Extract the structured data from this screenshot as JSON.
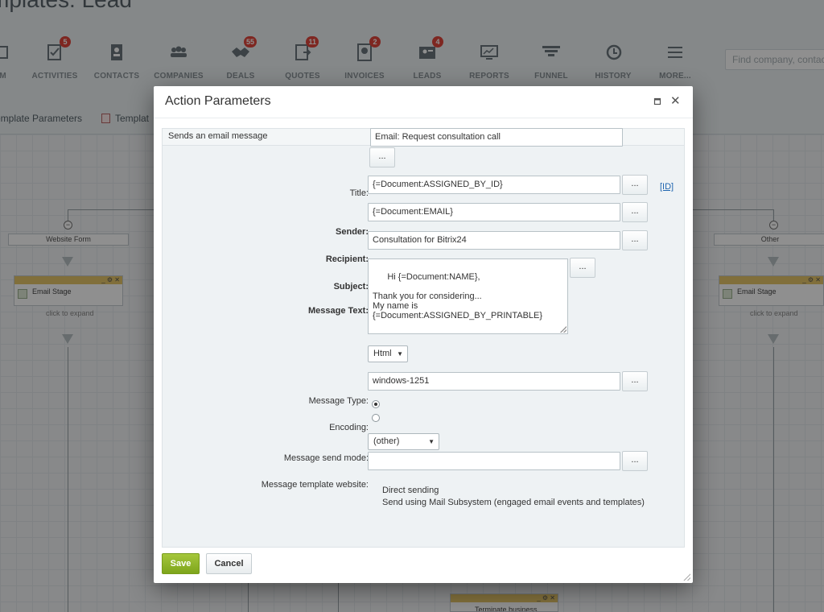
{
  "page": {
    "title": "mplates: Lead"
  },
  "nav": [
    {
      "label": "AM",
      "icon": "crm-icon",
      "badge": ""
    },
    {
      "label": "ACTIVITIES",
      "icon": "activities-icon",
      "badge": "5"
    },
    {
      "label": "CONTACTS",
      "icon": "contacts-icon",
      "badge": ""
    },
    {
      "label": "COMPANIES",
      "icon": "companies-icon",
      "badge": ""
    },
    {
      "label": "DEALS",
      "icon": "deals-icon",
      "badge": "55"
    },
    {
      "label": "QUOTES",
      "icon": "quotes-icon",
      "badge": "11"
    },
    {
      "label": "INVOICES",
      "icon": "invoices-icon",
      "badge": "2"
    },
    {
      "label": "LEADS",
      "icon": "leads-icon",
      "badge": "4"
    },
    {
      "label": "REPORTS",
      "icon": "reports-icon",
      "badge": ""
    },
    {
      "label": "FUNNEL",
      "icon": "funnel-icon",
      "badge": ""
    },
    {
      "label": "HISTORY",
      "icon": "history-icon",
      "badge": ""
    },
    {
      "label": "MORE...",
      "icon": "more-icon",
      "badge": ""
    }
  ],
  "search": {
    "placeholder": "Find company, contact"
  },
  "tabs": {
    "template_parameters": "emplate Parameters",
    "template": "Templat"
  },
  "workflow": {
    "left_branch": "Website Form",
    "right_branch": "Other",
    "stage_name": "Email Stage",
    "expand_hint": "click to expand",
    "terminate": "Terminate business"
  },
  "dialog": {
    "title": "Action Parameters",
    "description": "Sends an email message",
    "id_link": "[ID]",
    "dots": "...",
    "fields": {
      "title_label": "Title:",
      "title_value": "Email: Request consultation call",
      "sender_label": "Sender:",
      "sender_value": "{=Document:ASSIGNED_BY_ID}",
      "recipient_label": "Recipient:",
      "recipient_value": "{=Document:EMAIL}",
      "subject_label": "Subject:",
      "subject_value": "Consultation for Bitrix24",
      "message_label": "Message Text:",
      "message_value": "Hi {=Document:NAME},\n\nThank you for considering...\nMy name is\n{=Document:ASSIGNED_BY_PRINTABLE}",
      "type_label": "Message Type:",
      "type_value": "Html",
      "encoding_label": "Encoding:",
      "encoding_value": "windows-1251",
      "mode_label": "Message send mode:",
      "mode_option_direct": "Direct sending",
      "mode_option_subsystem": "Send using Mail Subsystem (engaged email events and templates)",
      "mode_selected": "Direct sending",
      "site_label": "Message template website:",
      "site_value": "(other)",
      "site_extra_value": ""
    },
    "buttons": {
      "save": "Save",
      "cancel": "Cancel"
    }
  }
}
